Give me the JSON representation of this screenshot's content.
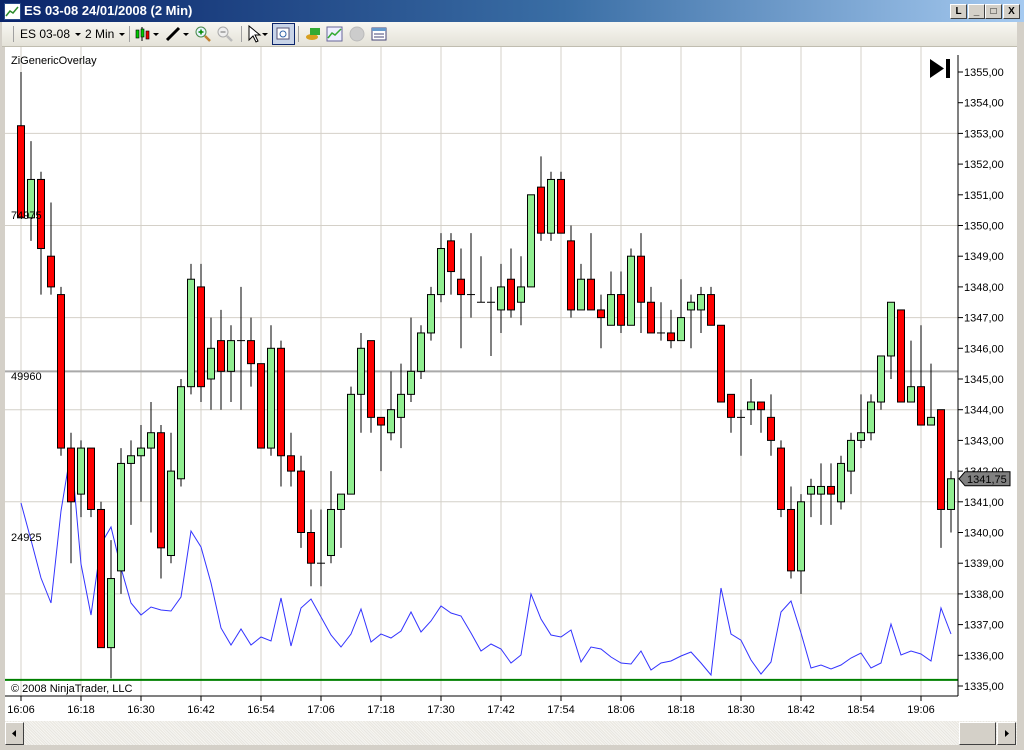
{
  "window": {
    "title": "ES 03-08  24/01/2008 (2 Min)",
    "buttons": {
      "link": "L",
      "minimize": "_",
      "maximize": "□",
      "close": "X"
    }
  },
  "toolbar": {
    "instrument": "ES 03-08",
    "interval": "2 Min",
    "icons": [
      "candlestick-style-icon",
      "drawing-pen-icon",
      "zoom-in-icon",
      "zoom-out-icon",
      "pointer-icon",
      "zoom-box-icon",
      "data-box-icon",
      "indicators-icon",
      "strategies-icon",
      "properties-icon"
    ]
  },
  "chart": {
    "indicator_label": "ZiGenericOverlay",
    "copyright": "© 2008 NinjaTrader, LLC",
    "last_price_label": "1341,75",
    "colors": {
      "up": "#90ee90",
      "down": "#ff0000",
      "overlay": "#3333ff",
      "hline": "#a9a9a9",
      "green_line": "#008000"
    }
  },
  "chart_data": {
    "type": "candlestick",
    "title": "ES 03-08 2 Min",
    "x_tick_labels": [
      "16:06",
      "16:18",
      "16:30",
      "16:42",
      "16:54",
      "17:06",
      "17:18",
      "17:30",
      "17:42",
      "17:54",
      "18:06",
      "18:18",
      "18:30",
      "18:42",
      "18:54",
      "19:06"
    ],
    "y_tick_labels": [
      "1355,00",
      "1354,00",
      "1353,00",
      "1352,00",
      "1351,00",
      "1350,00",
      "1349,00",
      "1348,00",
      "1347,00",
      "1346,00",
      "1345,00",
      "1344,00",
      "1343,00",
      "1342,00",
      "1341,00",
      "1340,00",
      "1339,00",
      "1338,00",
      "1337,00",
      "1336,00",
      "1335,00"
    ],
    "ylim": [
      1334.7,
      1355.7
    ],
    "bar_minutes": 2,
    "first_bar": "16:06",
    "horizontal_line_price": 1345.25,
    "green_line_price": 1335.2,
    "last_price": 1341.75,
    "ohlc": [
      [
        1353.25,
        1355.0,
        1350.25,
        1350.25
      ],
      [
        1350.25,
        1352.75,
        1349.5,
        1351.5
      ],
      [
        1351.5,
        1351.75,
        1347.75,
        1349.25
      ],
      [
        1349.0,
        1350.75,
        1347.75,
        1348.0
      ],
      [
        1347.75,
        1348.0,
        1342.5,
        1342.75
      ],
      [
        1342.75,
        1343.25,
        1339.0,
        1341.0
      ],
      [
        1341.25,
        1343.0,
        1340.5,
        1342.75
      ],
      [
        1342.75,
        1342.75,
        1340.5,
        1340.75
      ],
      [
        1340.75,
        1341.0,
        1336.25,
        1336.25
      ],
      [
        1336.25,
        1339.75,
        1335.25,
        1338.5
      ],
      [
        1338.75,
        1342.75,
        1338.0,
        1342.25
      ],
      [
        1342.25,
        1343.0,
        1340.25,
        1342.5
      ],
      [
        1342.5,
        1343.5,
        1341.0,
        1342.75
      ],
      [
        1342.75,
        1344.25,
        1340.0,
        1343.25
      ],
      [
        1343.25,
        1343.5,
        1338.5,
        1339.5
      ],
      [
        1339.25,
        1343.25,
        1339.0,
        1342.0
      ],
      [
        1341.75,
        1345.0,
        1341.5,
        1344.75
      ],
      [
        1344.75,
        1348.75,
        1344.5,
        1348.25
      ],
      [
        1348.0,
        1348.75,
        1344.25,
        1344.75
      ],
      [
        1345.0,
        1347.0,
        1344.0,
        1346.0
      ],
      [
        1346.25,
        1347.25,
        1344.0,
        1345.25
      ],
      [
        1345.25,
        1346.75,
        1344.25,
        1346.25
      ],
      [
        1346.25,
        1348.0,
        1344.0,
        1346.25
      ],
      [
        1346.25,
        1347.0,
        1344.75,
        1345.5
      ],
      [
        1345.5,
        1345.5,
        1342.75,
        1342.75
      ],
      [
        1342.75,
        1346.75,
        1342.5,
        1346.0
      ],
      [
        1346.0,
        1346.25,
        1341.5,
        1342.5
      ],
      [
        1342.5,
        1343.25,
        1341.5,
        1342.0
      ],
      [
        1342.0,
        1342.5,
        1339.5,
        1340.0
      ],
      [
        1340.0,
        1340.75,
        1338.25,
        1339.0
      ],
      [
        1339.0,
        1340.75,
        1338.25,
        1339.0
      ],
      [
        1339.25,
        1342.0,
        1339.0,
        1340.75
      ],
      [
        1340.75,
        1341.25,
        1339.5,
        1341.25
      ],
      [
        1341.25,
        1344.75,
        1341.25,
        1344.5
      ],
      [
        1344.5,
        1346.5,
        1343.25,
        1346.0
      ],
      [
        1346.25,
        1346.25,
        1343.25,
        1343.75
      ],
      [
        1343.75,
        1343.75,
        1342.0,
        1343.5
      ],
      [
        1343.25,
        1345.25,
        1343.0,
        1344.0
      ],
      [
        1343.75,
        1345.5,
        1342.75,
        1344.5
      ],
      [
        1344.5,
        1347.0,
        1344.25,
        1345.25
      ],
      [
        1345.25,
        1346.75,
        1345.0,
        1346.5
      ],
      [
        1346.5,
        1348.0,
        1346.25,
        1347.75
      ],
      [
        1347.75,
        1349.75,
        1347.5,
        1349.25
      ],
      [
        1349.5,
        1349.75,
        1347.75,
        1348.5
      ],
      [
        1348.25,
        1349.25,
        1346.0,
        1347.75
      ],
      [
        1347.75,
        1349.75,
        1347.0,
        1347.75
      ],
      [
        1347.5,
        1349.0,
        1347.5,
        1347.5
      ],
      [
        1347.5,
        1348.0,
        1345.75,
        1347.5
      ],
      [
        1347.25,
        1348.75,
        1346.5,
        1348.0
      ],
      [
        1348.25,
        1349.25,
        1347.0,
        1347.25
      ],
      [
        1347.5,
        1349.0,
        1346.75,
        1348.0
      ],
      [
        1348.0,
        1351.0,
        1348.0,
        1351.0
      ],
      [
        1351.25,
        1352.25,
        1349.5,
        1349.75
      ],
      [
        1349.75,
        1351.75,
        1349.5,
        1351.5
      ],
      [
        1351.5,
        1351.75,
        1349.75,
        1349.75
      ],
      [
        1349.5,
        1350.0,
        1347.0,
        1347.25
      ],
      [
        1347.25,
        1348.75,
        1347.25,
        1348.25
      ],
      [
        1348.25,
        1349.75,
        1347.25,
        1347.25
      ],
      [
        1347.25,
        1347.75,
        1346.0,
        1347.0
      ],
      [
        1346.75,
        1348.5,
        1346.75,
        1347.75
      ],
      [
        1347.75,
        1348.5,
        1346.5,
        1346.75
      ],
      [
        1346.75,
        1349.25,
        1346.75,
        1349.0
      ],
      [
        1349.0,
        1349.75,
        1346.5,
        1347.5
      ],
      [
        1347.5,
        1348.0,
        1346.5,
        1346.5
      ],
      [
        1346.5,
        1347.5,
        1346.25,
        1346.5
      ],
      [
        1346.5,
        1347.25,
        1346.0,
        1346.25
      ],
      [
        1346.25,
        1348.25,
        1346.25,
        1347.0
      ],
      [
        1347.25,
        1347.75,
        1346.0,
        1347.5
      ],
      [
        1347.25,
        1348.0,
        1346.5,
        1347.75
      ],
      [
        1347.75,
        1348.0,
        1346.75,
        1346.75
      ],
      [
        1346.75,
        1346.75,
        1344.25,
        1344.25
      ],
      [
        1344.5,
        1344.5,
        1343.25,
        1343.75
      ],
      [
        1343.75,
        1344.0,
        1342.5,
        1343.75
      ],
      [
        1344.0,
        1345.0,
        1343.5,
        1344.25
      ],
      [
        1344.25,
        1344.25,
        1343.25,
        1344.0
      ],
      [
        1343.75,
        1344.5,
        1342.5,
        1343.0
      ],
      [
        1342.75,
        1343.0,
        1340.5,
        1340.75
      ],
      [
        1340.75,
        1341.5,
        1338.5,
        1338.75
      ],
      [
        1338.75,
        1341.25,
        1338.0,
        1341.0
      ],
      [
        1341.25,
        1341.75,
        1340.5,
        1341.5
      ],
      [
        1341.25,
        1342.25,
        1340.25,
        1341.5
      ],
      [
        1341.5,
        1342.25,
        1340.25,
        1341.25
      ],
      [
        1341.0,
        1342.5,
        1340.75,
        1342.25
      ],
      [
        1342.0,
        1343.25,
        1341.25,
        1343.0
      ],
      [
        1343.0,
        1344.5,
        1342.75,
        1343.25
      ],
      [
        1343.25,
        1344.5,
        1343.0,
        1344.25
      ],
      [
        1344.25,
        1345.75,
        1344.0,
        1345.75
      ],
      [
        1345.75,
        1347.5,
        1345.0,
        1347.5
      ],
      [
        1347.25,
        1347.25,
        1344.25,
        1344.25
      ],
      [
        1344.25,
        1346.25,
        1344.25,
        1344.75
      ],
      [
        1344.75,
        1346.75,
        1343.5,
        1343.5
      ],
      [
        1343.5,
        1345.5,
        1343.5,
        1343.75
      ],
      [
        1344.0,
        1344.0,
        1339.5,
        1340.75
      ],
      [
        1340.75,
        1342.0,
        1340.0,
        1341.75
      ]
    ],
    "overlay_axis_labels": [
      "74975",
      "49960",
      "24925"
    ],
    "overlay_axis_values": [
      74975,
      49960,
      24925
    ],
    "overlay_series": [
      30224,
      24474,
      18569,
      14684,
      28981,
      38460,
      20745,
      12819,
      23853,
      26495,
      20123,
      14684,
      12819,
      14063,
      13596,
      13441,
      15617,
      25873,
      23387,
      17792,
      10799,
      8157,
      10644,
      8157,
      9401,
      8779,
      15461,
      8002,
      13907,
      15306,
      12509,
      9711,
      7847,
      9867,
      13752,
      8624,
      9867,
      9245,
      10333,
      13286,
      10178,
      11887,
      14218,
      13130,
      12664,
      10022,
      7225,
      8313,
      7536,
      5360,
      6603,
      16083,
      12198,
      9711,
      9401,
      10488,
      5516,
      7847,
      7536,
      6293,
      5360,
      5205,
      7225,
      4272,
      5360,
      5671,
      6448,
      7070,
      5360,
      3495,
      17015,
      9867,
      8900,
      5826,
      3651,
      5516,
      13286,
      14995,
      10022,
      4583,
      5049,
      4428,
      5049,
      6137,
      6914,
      4583,
      5360,
      11421,
      6603,
      7225,
      6759,
      5671,
      13907,
      9867
    ]
  }
}
